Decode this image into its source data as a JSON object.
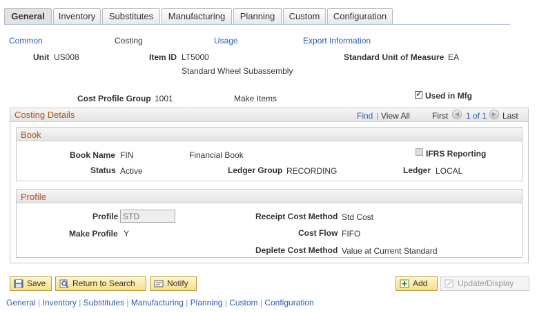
{
  "tabs": [
    "General",
    "Inventory",
    "Substitutes",
    "Manufacturing",
    "Planning",
    "Custom",
    "Configuration"
  ],
  "subnav": {
    "common": "Common",
    "costing": "Costing",
    "usage": "Usage",
    "export": "Export Information"
  },
  "header": {
    "unit_label": "Unit",
    "unit_value": "US008",
    "item_label": "Item ID",
    "item_value": "LT5000",
    "item_desc": "Standard Wheel Subassembly",
    "uom_label": "Standard Unit of Measure",
    "uom_value": "EA",
    "cpg_label": "Cost Profile Group",
    "cpg_value": "1001",
    "cpg_desc": "Make Items",
    "used_mfg_label": "Used in Mfg",
    "used_mfg_checked": true
  },
  "costing": {
    "title": "Costing Details",
    "find": "Find",
    "view_all": "View All",
    "first": "First",
    "range": "1 of 1",
    "last": "Last"
  },
  "book": {
    "title": "Book",
    "book_name_label": "Book Name",
    "book_name_value": "FIN",
    "book_desc": "Financial Book",
    "ifrs_label": "IFRS Reporting",
    "status_label": "Status",
    "status_value": "Active",
    "ledger_group_label": "Ledger Group",
    "ledger_group_value": "RECORDING",
    "ledger_label": "Ledger",
    "ledger_value": "LOCAL"
  },
  "profile": {
    "title": "Profile",
    "profile_label": "Profile",
    "profile_value": "STD",
    "make_profile_label": "Make Profile",
    "make_profile_value": "Y",
    "receipt_label": "Receipt Cost Method",
    "receipt_value": "Std Cost",
    "flow_label": "Cost Flow",
    "flow_value": "FIFO",
    "deplete_label": "Deplete Cost Method",
    "deplete_value": "Value at Current Standard"
  },
  "toolbar": {
    "save": "Save",
    "return": "Return to Search",
    "notify": "Notify",
    "add": "Add",
    "update": "Update/Display"
  },
  "footer": [
    "General",
    "Inventory",
    "Substitutes",
    "Manufacturing",
    "Planning",
    "Custom",
    "Configuration"
  ],
  "colors": {
    "link": "#2a5db0",
    "section_title": "#b0541c",
    "button_bg": "#f5e08a"
  }
}
